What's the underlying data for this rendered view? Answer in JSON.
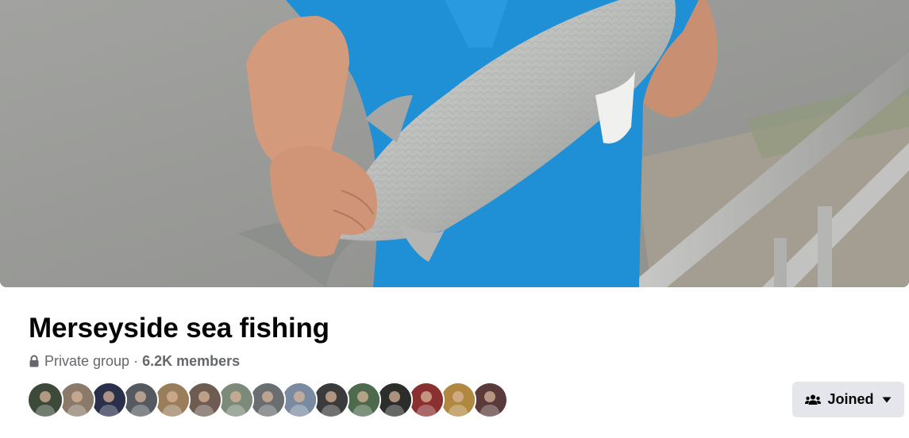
{
  "group": {
    "name": "Merseyside sea fishing",
    "privacy": "Private group",
    "separator": "·",
    "member_count": "6.2K members"
  },
  "cover": {
    "description_icon": "cover-photo"
  },
  "members": {
    "avatars": [
      {
        "name": "member-avatar-1",
        "color": "#3d4a3a"
      },
      {
        "name": "member-avatar-2",
        "color": "#8b7a6a"
      },
      {
        "name": "member-avatar-3",
        "color": "#2a2f4a"
      },
      {
        "name": "member-avatar-4",
        "color": "#555a60"
      },
      {
        "name": "member-avatar-5",
        "color": "#9a7e5c"
      },
      {
        "name": "member-avatar-6",
        "color": "#6e5b52"
      },
      {
        "name": "member-avatar-7",
        "color": "#7c8a7a"
      },
      {
        "name": "member-avatar-8",
        "color": "#6a6e70"
      },
      {
        "name": "member-avatar-9",
        "color": "#7a8aa0"
      },
      {
        "name": "member-avatar-10",
        "color": "#3b3b3b"
      },
      {
        "name": "member-avatar-11",
        "color": "#4d6a4c"
      },
      {
        "name": "member-avatar-12",
        "color": "#2b2e2a"
      },
      {
        "name": "member-avatar-13",
        "color": "#8a3030"
      },
      {
        "name": "member-avatar-14",
        "color": "#b0883f"
      },
      {
        "name": "member-avatar-15",
        "color": "#5a3a3a"
      }
    ]
  },
  "actions": {
    "joined_label": "Joined",
    "joined_icon": "group-members-icon",
    "dropdown_icon": "caret-down-icon"
  },
  "colors": {
    "button_bg": "#e4e6eb",
    "secondary_text": "#65676b",
    "primary_text": "#050505",
    "shirt_blue": "#1f8fd6"
  }
}
